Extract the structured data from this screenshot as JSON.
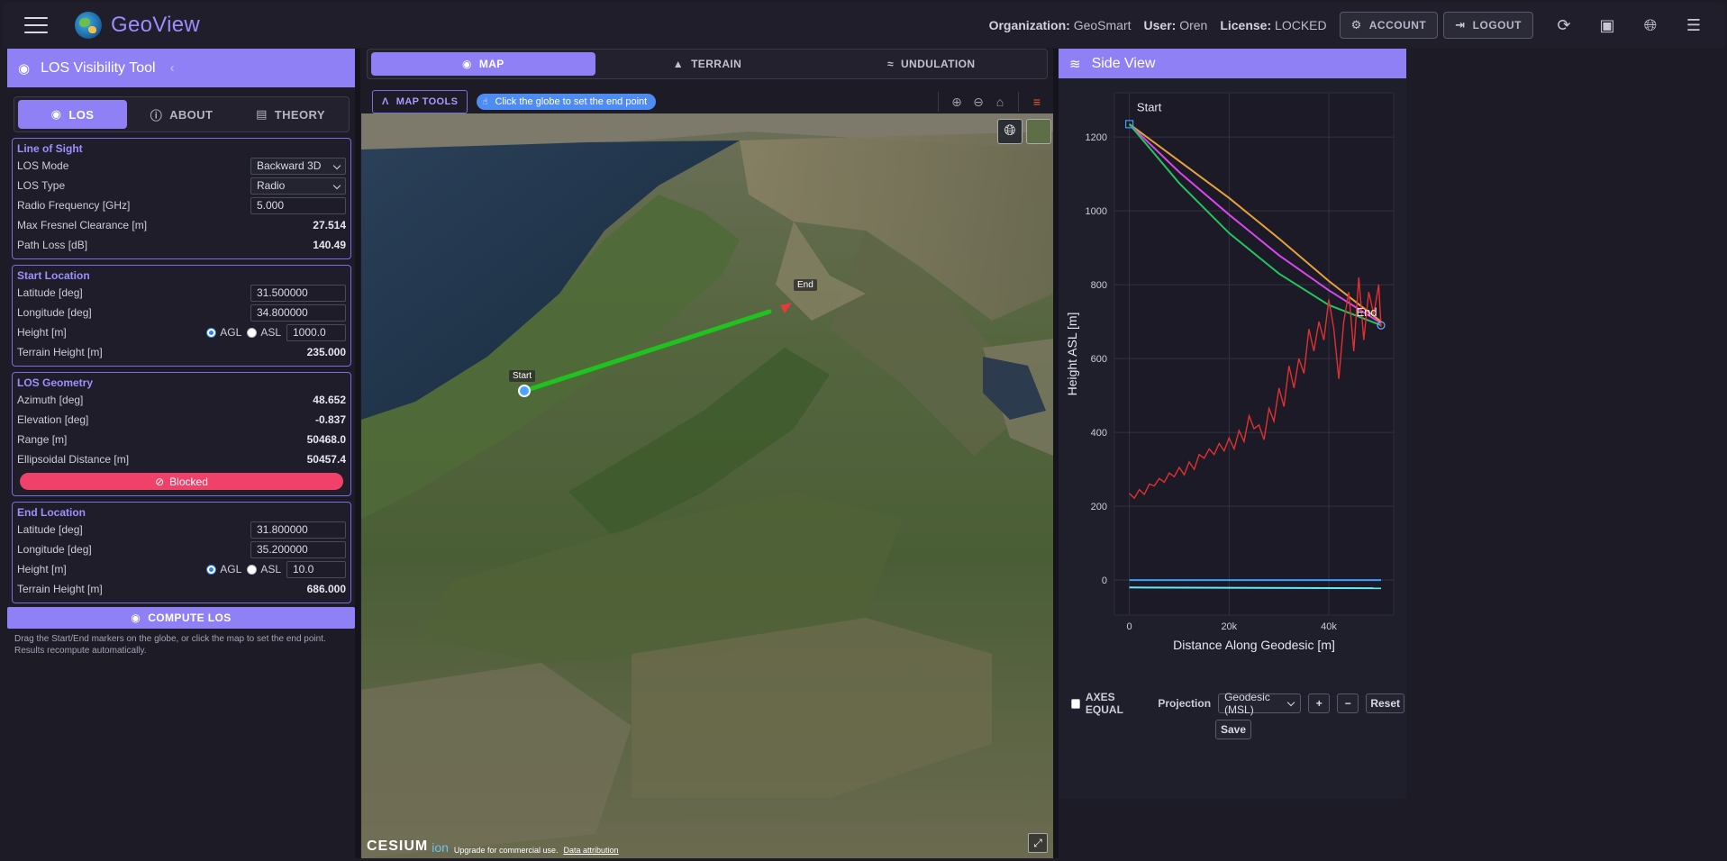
{
  "header": {
    "app_title": "GeoView",
    "org_label": "Organization:",
    "org_value": "GeoSmart",
    "user_label": "User:",
    "user_value": "Oren",
    "license_label": "License:",
    "license_value": "LOCKED",
    "account_label": "ACCOUNT",
    "logout_label": "LOGOUT"
  },
  "left_panel": {
    "title": "LOS Visibility Tool",
    "tabs": [
      {
        "label": "LOS",
        "active": true
      },
      {
        "label": "ABOUT",
        "active": false
      },
      {
        "label": "THEORY",
        "active": false
      }
    ],
    "line_of_sight": {
      "title": "Line of Sight",
      "los_mode_label": "LOS Mode",
      "los_mode_value": "Backward 3D",
      "los_type_label": "LOS Type",
      "los_type_value": "Radio",
      "freq_label": "Radio Frequency [GHz]",
      "freq_value": "5.000",
      "fresnel_label": "Max Fresnel Clearance [m]",
      "fresnel_value": "27.514",
      "pathloss_label": "Path Loss [dB]",
      "pathloss_value": "140.49"
    },
    "start_location": {
      "title": "Start Location",
      "lat_label": "Latitude [deg]",
      "lat_value": "31.500000",
      "lon_label": "Longitude [deg]",
      "lon_value": "34.800000",
      "height_label": "Height [m]",
      "agl_label": "AGL",
      "asl_label": "ASL",
      "height_value": "1000.0",
      "terrain_label": "Terrain Height [m]",
      "terrain_value": "235.000"
    },
    "geometry": {
      "title": "LOS Geometry",
      "az_label": "Azimuth [deg]",
      "az_value": "48.652",
      "el_label": "Elevation [deg]",
      "el_value": "-0.837",
      "range_label": "Range [m]",
      "range_value": "50468.0",
      "ell_label": "Ellipsoidal Distance [m]",
      "ell_value": "50457.4",
      "status_label": "Blocked"
    },
    "end_location": {
      "title": "End Location",
      "lat_label": "Latitude [deg]",
      "lat_value": "31.800000",
      "lon_label": "Longitude [deg]",
      "lon_value": "35.200000",
      "height_label": "Height [m]",
      "agl_label": "AGL",
      "asl_label": "ASL",
      "height_value": "10.0",
      "terrain_label": "Terrain Height [m]",
      "terrain_value": "686.000"
    },
    "compute_label": "COMPUTE LOS",
    "help_text": "Drag the Start/End markers on the globe, or click the map to set the end point. Results recompute automatically."
  },
  "center": {
    "tabs": [
      {
        "label": "MAP",
        "active": true
      },
      {
        "label": "TERRAIN",
        "active": false
      },
      {
        "label": "UNDULATION",
        "active": false
      }
    ],
    "map_tools_label": "MAP TOOLS",
    "hint": "Click the globe to set the end point",
    "marker_start": "Start",
    "marker_end": "End",
    "cesium_brand": "CESIUM",
    "cesium_ion": "ion",
    "cesium_upgrade": "Upgrade for commercial use.",
    "cesium_attribution": "Data attribution"
  },
  "right_panel": {
    "title": "Side View",
    "axes_equal_label": "AXES EQUAL",
    "projection_label": "Projection",
    "projection_value": "Geodesic (MSL)",
    "plus_label": "+",
    "minus_label": "−",
    "reset_label": "Reset",
    "save_label": "Save"
  },
  "chart_data": {
    "type": "line",
    "xlabel": "Distance Along Geodesic [m]",
    "ylabel": "Height ASL [m]",
    "xlim": [
      -3000,
      53000
    ],
    "ylim": [
      -95,
      1320
    ],
    "x_ticks": [
      0,
      20000,
      40000
    ],
    "x_tick_labels": [
      "0",
      "20k",
      "40k"
    ],
    "y_ticks": [
      0,
      200,
      400,
      600,
      800,
      1000,
      1200
    ],
    "annotations": [
      {
        "text": "Start",
        "x": 1500,
        "y": 1270
      },
      {
        "text": "End",
        "x": 45500,
        "y": 715
      }
    ],
    "series": [
      {
        "color": "#e6a23c",
        "x": [
          0,
          10000,
          20000,
          30000,
          40000,
          50468
        ],
        "y": [
          1235,
          1135,
          1035,
          925,
          810,
          700
        ]
      },
      {
        "color": "#d946ef",
        "x": [
          0,
          10000,
          20000,
          30000,
          40000,
          50468
        ],
        "y": [
          1235,
          1105,
          990,
          880,
          785,
          696
        ]
      },
      {
        "color": "#22c55e",
        "x": [
          0,
          10000,
          20000,
          30000,
          40000,
          50468
        ],
        "y": [
          1235,
          1075,
          940,
          830,
          745,
          690
        ]
      },
      {
        "color": "#e03131",
        "x": [
          0,
          1000,
          2000,
          3000,
          4000,
          5000,
          6000,
          7000,
          8000,
          9000,
          10000,
          11000,
          12000,
          13000,
          14000,
          15000,
          16000,
          17000,
          18000,
          19000,
          20000,
          21000,
          22000,
          23000,
          24000,
          25000,
          26000,
          27000,
          28000,
          29000,
          30000,
          31000,
          32000,
          33000,
          34000,
          35000,
          36000,
          37000,
          38000,
          39000,
          40000,
          41000,
          42000,
          43000,
          44000,
          45000,
          46000,
          47000,
          48000,
          49000,
          50000,
          50468
        ],
        "y": [
          235,
          222,
          245,
          232,
          260,
          255,
          275,
          265,
          290,
          280,
          305,
          285,
          320,
          300,
          340,
          330,
          355,
          340,
          370,
          350,
          385,
          355,
          405,
          375,
          445,
          410,
          420,
          380,
          465,
          430,
          520,
          470,
          580,
          520,
          600,
          560,
          680,
          620,
          700,
          650,
          760,
          680,
          545,
          700,
          780,
          620,
          820,
          650,
          780,
          720,
          800,
          686
        ]
      },
      {
        "color": "#3aa0ff",
        "x": [
          0,
          50468
        ],
        "y": [
          0,
          0
        ]
      },
      {
        "color": "#67e8f9",
        "x": [
          0,
          50468
        ],
        "y": [
          -20,
          -22
        ]
      }
    ]
  }
}
